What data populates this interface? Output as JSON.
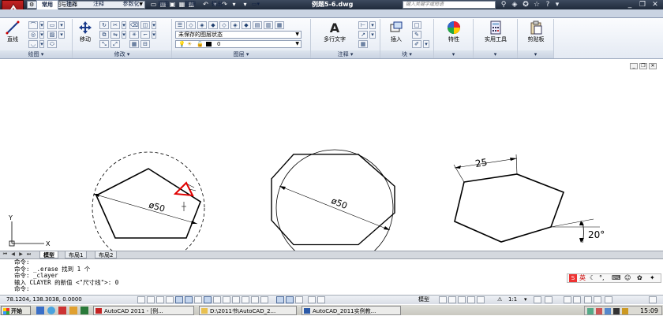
{
  "titlebar": {
    "workspace": "二维草图与注释",
    "document_title": "例题5-6.dwg",
    "help_search_placeholder": "键入关键字或短语"
  },
  "tabs": [
    "常用",
    "插入",
    "注释",
    "参数化",
    "视图",
    "管理",
    "输出"
  ],
  "active_tab": "常用",
  "ribbon": {
    "draw": {
      "title": "绘图",
      "line_label": "直线"
    },
    "modify": {
      "title": "修改",
      "move_label": "移动"
    },
    "layers": {
      "title": "图层",
      "layer_state": "未保存的图层状态",
      "current_layer": "0"
    },
    "annotation": {
      "title": "注释",
      "mtext_label": "多行文字"
    },
    "block": {
      "title": "块",
      "insert_label": "插入"
    },
    "properties_label": "特性",
    "utilities_label": "实用工具",
    "clipboard_label": "剪贴板"
  },
  "drawing": {
    "dim_diameter_1": "ø50",
    "dim_diameter_2": "ø50",
    "dim_length": "25",
    "dim_angle": "20°",
    "ucs_x": "X",
    "ucs_y": "Y"
  },
  "layout_tabs": [
    "模型",
    "布局1",
    "布局2"
  ],
  "active_layout": "模型",
  "command_lines": [
    "命令:",
    "命令: _.erase 找到 1 个",
    "命令: _clayer",
    "输入 CLAYER 的新值 <\"尺寸线\">: 0",
    "命令:"
  ],
  "ime": {
    "lang": "英"
  },
  "status": {
    "coordinates": "78.1204,  138.3038,  0.0000",
    "model_label": "模型",
    "annotation_scale": "1:1"
  },
  "taskbar": {
    "start": "开始",
    "items": [
      "AutoCAD 2011 - [例...",
      "D:\\2011书\\AutoCAD_2...",
      "AutoCAD_2011实例教..."
    ],
    "clock": "15:09"
  },
  "colors": {
    "titlebar": "#2a3547",
    "ribbon": "#e4eaf3",
    "highlight": "#e00000"
  }
}
